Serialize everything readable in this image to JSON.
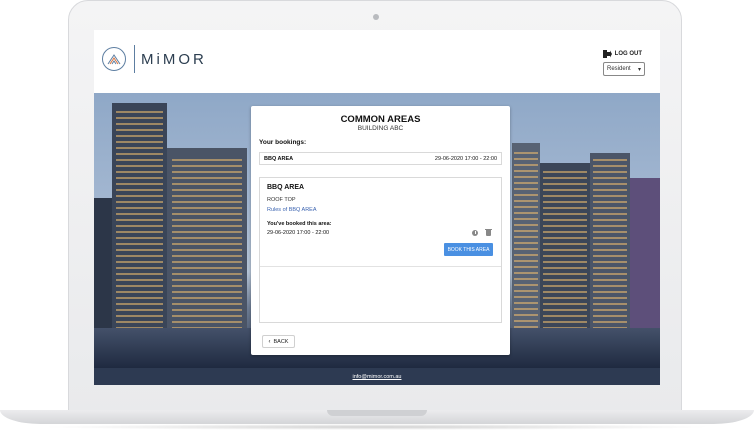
{
  "header": {
    "logo_text": "MiMOR",
    "logout_label": "LOG OUT",
    "role_selected": "Resident",
    "icons": [
      "logo-mountain-icon",
      "logout-icon",
      "chevron-down-icon"
    ]
  },
  "card": {
    "title": "COMMON AREAS",
    "subtitle": "BUILDING ABC",
    "bookings_label": "Your bookings:",
    "booking": {
      "name": "BBQ AREA",
      "time": "29-06-2020 17:00 - 22:00"
    },
    "detail": {
      "title": "BBQ AREA",
      "location": "ROOF TOP",
      "rules_link": "Rules of BBQ AREA",
      "booked_label": "You've booked this area:",
      "booked_time": "29-06-2020 17:00 - 22:00",
      "book_button": "BOOK THIS AREA",
      "icons": [
        "clock-icon",
        "trash-icon"
      ]
    },
    "back_label": "BACK"
  },
  "footer": {
    "email": "info@mimor.com.au"
  },
  "colors": {
    "accent": "#4a90e2",
    "link": "#3b63b0",
    "footer": "#2d3a52",
    "logo": "#5d7ea1"
  }
}
